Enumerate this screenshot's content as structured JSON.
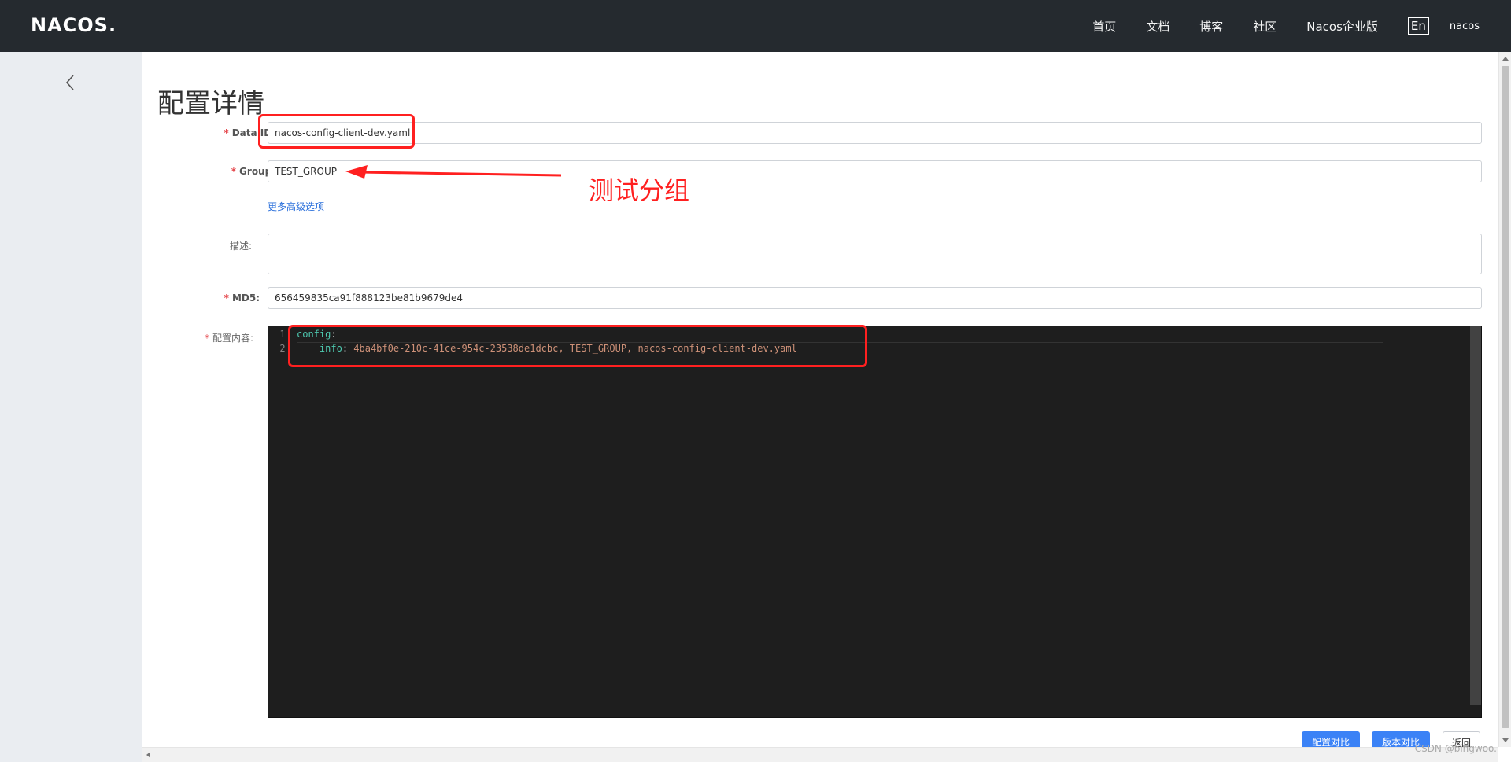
{
  "header": {
    "logo": "NACOS.",
    "nav": [
      "首页",
      "文档",
      "博客",
      "社区",
      "Nacos企业版"
    ],
    "lang_button": "En",
    "user": "nacos"
  },
  "page": {
    "title": "配置详情"
  },
  "form": {
    "data_id": {
      "label": "Data ID:",
      "value": "nacos-config-client-dev.yaml"
    },
    "group": {
      "label": "Group:",
      "value": "TEST_GROUP"
    },
    "advanced_link": "更多高级选项",
    "description": {
      "label": "描述:",
      "value": ""
    },
    "md5": {
      "label": "MD5:",
      "value": "656459835ca91f888123be81b9679de4"
    },
    "content": {
      "label": "配置内容:"
    }
  },
  "editor": {
    "lines": [
      {
        "num": "1",
        "key": "config",
        "colon": ":",
        "value": ""
      },
      {
        "num": "2",
        "key": "info",
        "colon": ": ",
        "value": "4ba4bf0e-210c-41ce-954c-23538de1dcbc, TEST_GROUP, nacos-config-client-dev.yaml"
      }
    ]
  },
  "buttons": {
    "compare_config": "配置对比",
    "compare_version": "版本对比",
    "back": "返回"
  },
  "annotation": {
    "text": "测试分组",
    "color": "#ff2020"
  },
  "watermark": "CSDN @bingwoo."
}
